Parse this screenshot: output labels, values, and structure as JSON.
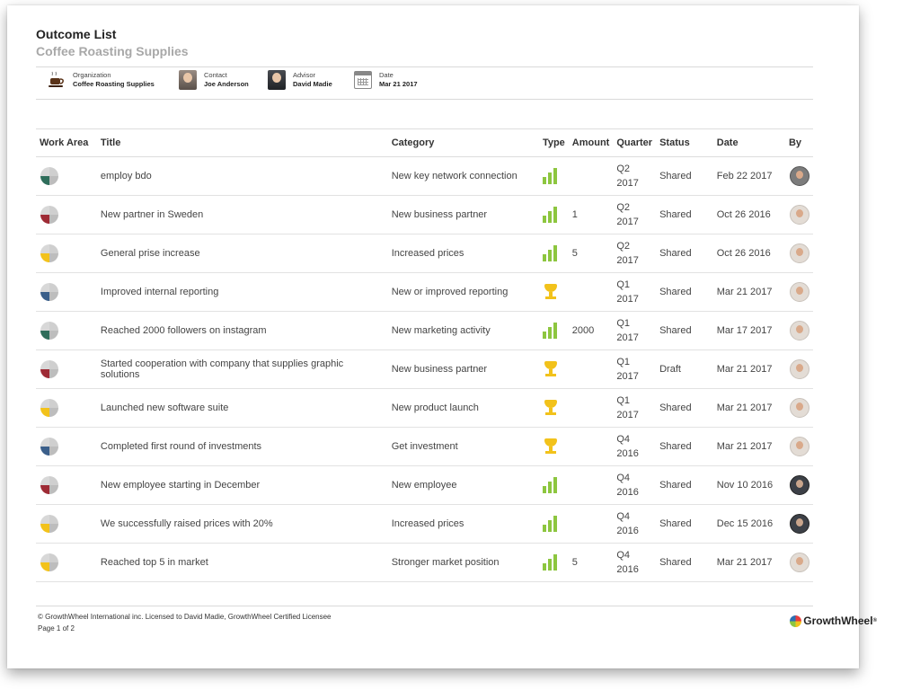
{
  "header": {
    "title": "Outcome List",
    "subtitle": "Coffee Roasting Supplies"
  },
  "meta": {
    "organization": {
      "label": "Organization",
      "value": "Coffee Roasting Supplies",
      "icon": "coffee-cup-icon"
    },
    "contact": {
      "label": "Contact",
      "value": "Joe Anderson",
      "icon": "contact-avatar"
    },
    "advisor": {
      "label": "Advisor",
      "value": "David Madie",
      "icon": "advisor-avatar"
    },
    "date": {
      "label": "Date",
      "value": "Mar 21 2017",
      "icon": "calendar-icon"
    }
  },
  "table": {
    "columns": [
      "Work Area",
      "Title",
      "Category",
      "Type",
      "Amount",
      "Quarter",
      "Status",
      "Date",
      "By"
    ],
    "rows": [
      {
        "work_area": "green",
        "title": "employ bdo",
        "category": "New key network connection",
        "type": "bars",
        "amount": "",
        "quarter": "Q2\n2017",
        "status": "Shared",
        "date": "Feb 22 2017",
        "by": "gray"
      },
      {
        "work_area": "red",
        "title": "New partner in Sweden",
        "category": "New business partner",
        "type": "bars",
        "amount": "1",
        "quarter": "Q2\n2017",
        "status": "Shared",
        "date": "Oct 26 2016",
        "by": "light"
      },
      {
        "work_area": "yellow",
        "title": "General prise increase",
        "category": "Increased prices",
        "type": "bars",
        "amount": "5",
        "quarter": "Q2\n2017",
        "status": "Shared",
        "date": "Oct 26 2016",
        "by": "light"
      },
      {
        "work_area": "blue",
        "title": "Improved internal reporting",
        "category": "New or improved reporting",
        "type": "trophy",
        "amount": "",
        "quarter": "Q1\n2017",
        "status": "Shared",
        "date": "Mar 21 2017",
        "by": "light"
      },
      {
        "work_area": "green",
        "title": "Reached 2000 followers on instagram",
        "category": "New marketing activity",
        "type": "bars",
        "amount": "2000",
        "quarter": "Q1\n2017",
        "status": "Shared",
        "date": "Mar 17 2017",
        "by": "light"
      },
      {
        "work_area": "red",
        "title": "Started cooperation with company that supplies graphic solutions",
        "category": "New business partner",
        "type": "trophy",
        "amount": "",
        "quarter": "Q1\n2017",
        "status": "Draft",
        "date": "Mar 21 2017",
        "by": "light"
      },
      {
        "work_area": "yellow",
        "title": "Launched new software suite",
        "category": "New product launch",
        "type": "trophy",
        "amount": "",
        "quarter": "Q1\n2017",
        "status": "Shared",
        "date": "Mar 21 2017",
        "by": "light"
      },
      {
        "work_area": "blue",
        "title": "Completed first round of investments",
        "category": "Get investment",
        "type": "trophy",
        "amount": "",
        "quarter": "Q4\n2016",
        "status": "Shared",
        "date": "Mar 21 2017",
        "by": "light"
      },
      {
        "work_area": "red",
        "title": "New employee starting in December",
        "category": "New employee",
        "type": "bars",
        "amount": "",
        "quarter": "Q4\n2016",
        "status": "Shared",
        "date": "Nov 10 2016",
        "by": "dark"
      },
      {
        "work_area": "yellow",
        "title": "We successfully raised prices with 20%",
        "category": "Increased prices",
        "type": "bars",
        "amount": "",
        "quarter": "Q4\n2016",
        "status": "Shared",
        "date": "Dec 15 2016",
        "by": "dark"
      },
      {
        "work_area": "yellow",
        "title": "Reached top 5 in market",
        "category": "Stronger market position",
        "type": "bars",
        "amount": "5",
        "quarter": "Q4\n2016",
        "status": "Shared",
        "date": "Mar 21 2017",
        "by": "light"
      }
    ]
  },
  "footer": {
    "copyright": "© GrowthWheel International inc. Licensed to David Madie, GrowthWheel Certified Licensee",
    "page": "Page 1 of 2",
    "brand": "GrowthWheel",
    "brand_mark": "®"
  },
  "colors": {
    "accent_bars": "#8dc63f",
    "trophy": "#f2c21b",
    "work_area_green": "#2f6e5b",
    "work_area_red": "#9e2b35",
    "work_area_yellow": "#f2c21b",
    "work_area_blue": "#3b5f8a",
    "subtitle": "#a8a8a8"
  }
}
